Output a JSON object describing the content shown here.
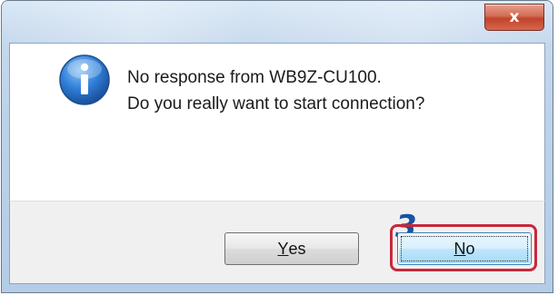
{
  "window": {
    "close_glyph": "x"
  },
  "dialog": {
    "icon": "info-icon",
    "message_line1": "No response from WB9Z-CU100.",
    "message_line2": "Do you really want to start connection?"
  },
  "annotation": {
    "step_number": "3"
  },
  "buttons": {
    "yes": {
      "accel": "Y",
      "rest": "es"
    },
    "no": {
      "accel": "N",
      "rest": "o"
    }
  },
  "colors": {
    "step_label": "#1553a4",
    "highlight_border": "#c8283b",
    "close_button": "#c2432a"
  }
}
